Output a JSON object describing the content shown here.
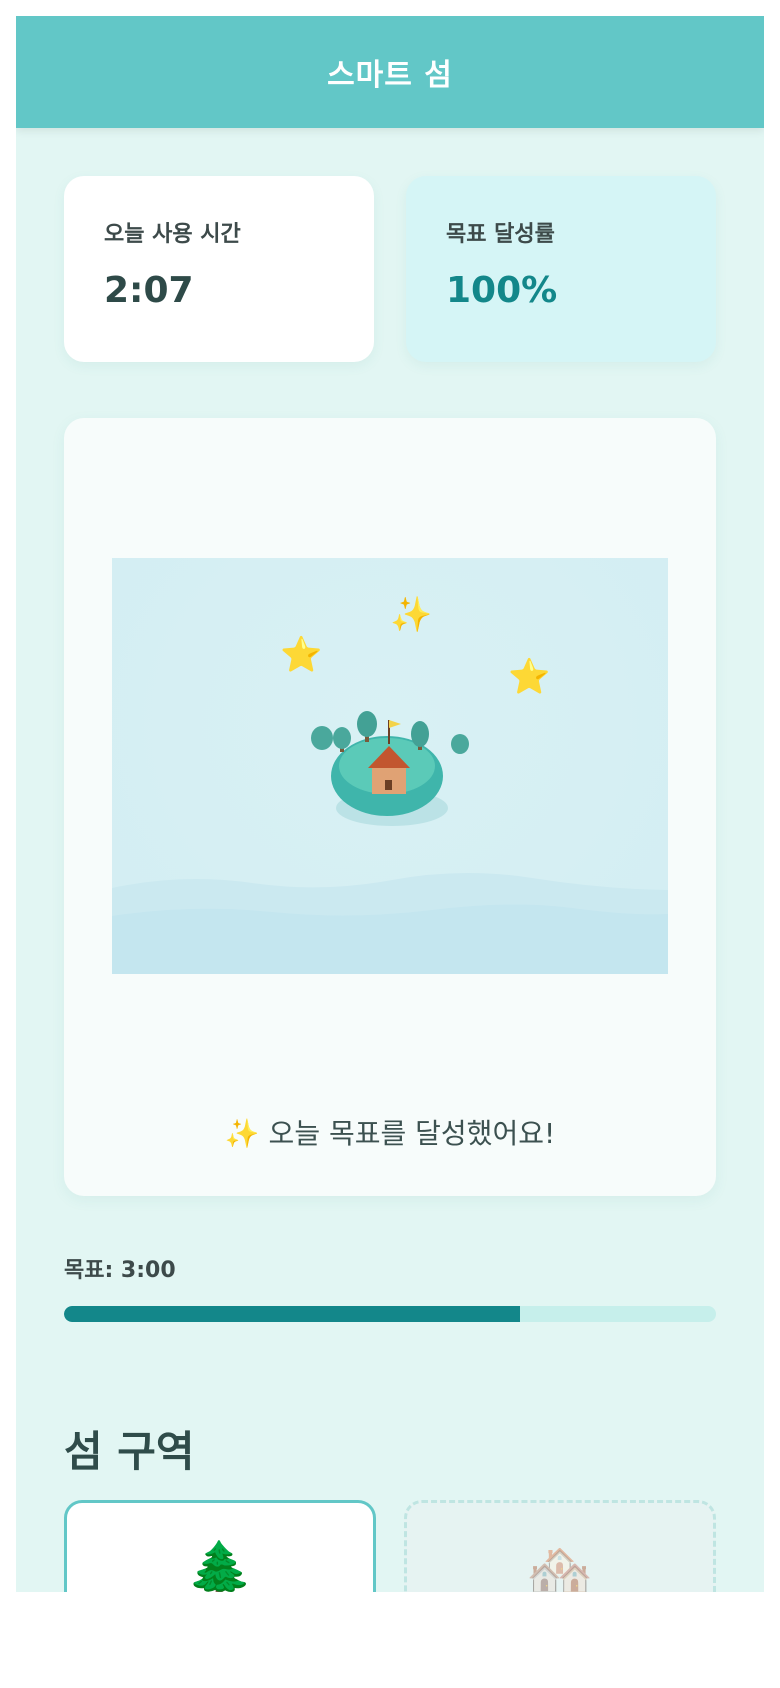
{
  "header": {
    "title": "스마트 섬"
  },
  "stats": {
    "today_usage": {
      "label": "오늘 사용 시간",
      "value": "2:07"
    },
    "goal_rate": {
      "label": "목표 달성률",
      "value": "100%"
    }
  },
  "island": {
    "message": "✨ 오늘 목표를 달성했어요!",
    "decorations": {
      "star": "⭐",
      "sparkle": "✨"
    }
  },
  "goal": {
    "label": "목표: 3:00",
    "progress": 0.7
  },
  "zones": {
    "title": "섬 구역",
    "items": [
      {
        "icon": "🌲",
        "icon_name": "tree-icon",
        "state": "unlocked"
      },
      {
        "icon": "🏘️",
        "icon_name": "houses-icon",
        "state": "locked"
      }
    ]
  },
  "colors": {
    "primary": "#62c7c7",
    "accent": "#13878a",
    "background": "#e2f6f3"
  }
}
